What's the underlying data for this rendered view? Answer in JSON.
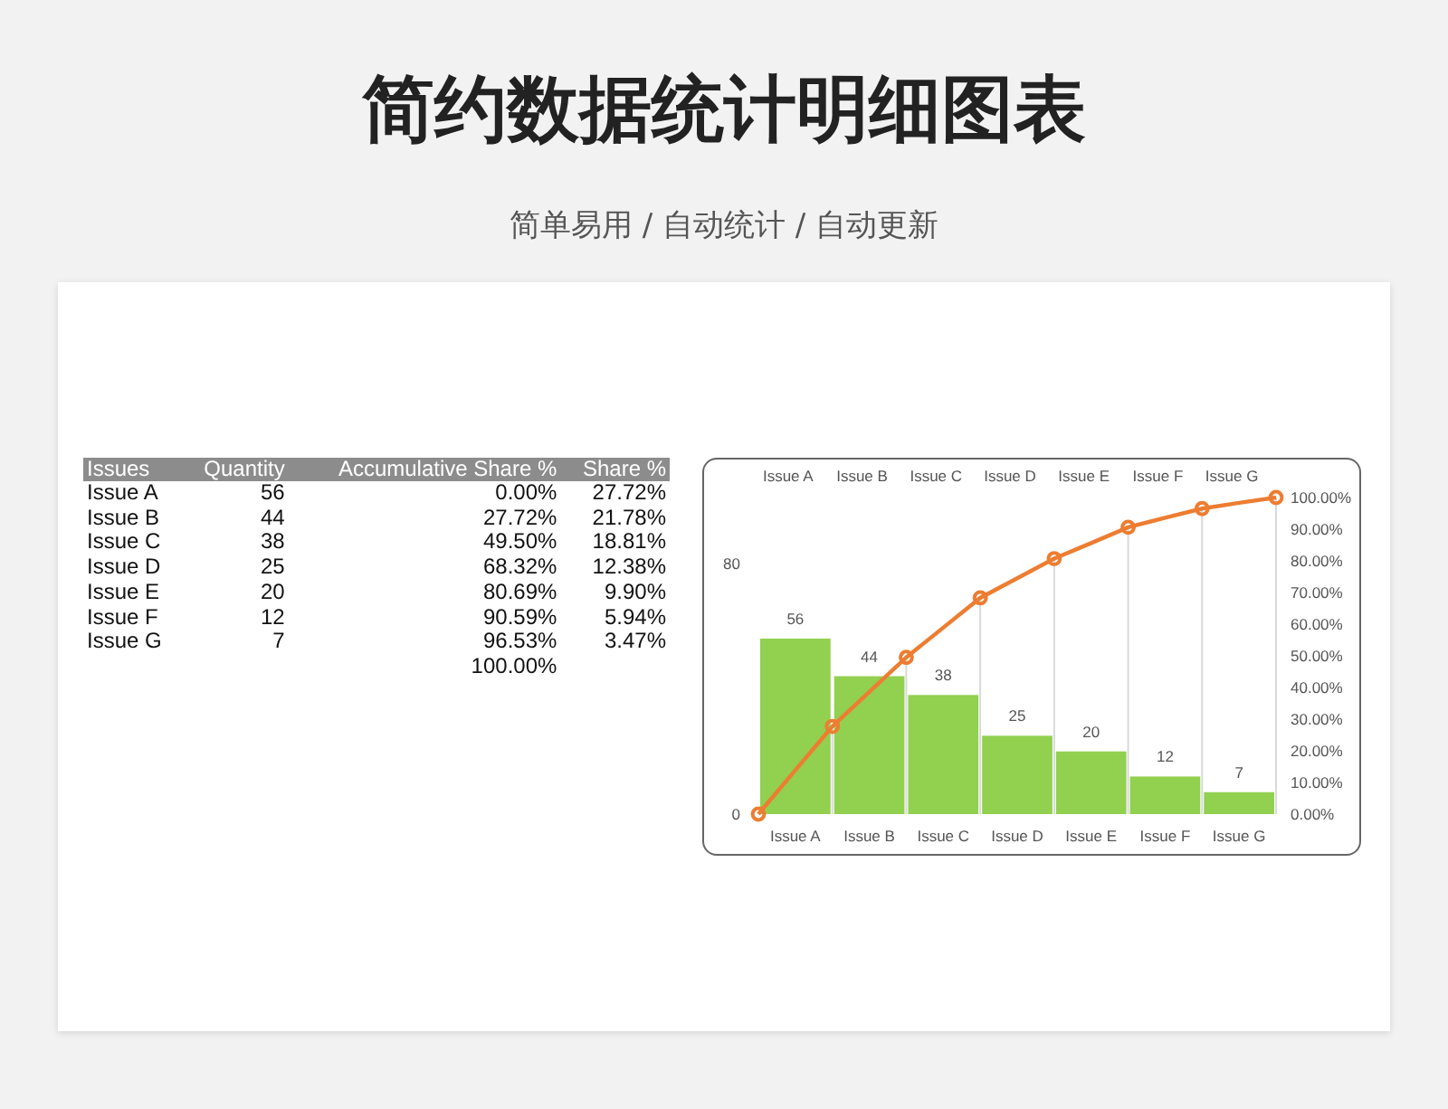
{
  "title": "简约数据统计明细图表",
  "subtitle": "简单易用 / 自动统计 / 自动更新",
  "table": {
    "columns": [
      "Issues",
      "Quantity",
      "Accumulative Share %",
      "Share %"
    ],
    "rows": [
      [
        "Issue A",
        "56",
        "0.00%",
        "27.72%"
      ],
      [
        "Issue B",
        "44",
        "27.72%",
        "21.78%"
      ],
      [
        "Issue C",
        "38",
        "49.50%",
        "18.81%"
      ],
      [
        "Issue D",
        "25",
        "68.32%",
        "12.38%"
      ],
      [
        "Issue E",
        "20",
        "80.69%",
        "9.90%"
      ],
      [
        "Issue F",
        "12",
        "90.59%",
        "5.94%"
      ],
      [
        "Issue G",
        "7",
        "96.53%",
        "3.47%"
      ],
      [
        "",
        "",
        "100.00%",
        ""
      ]
    ]
  },
  "chart": {
    "top_labels": [
      "Issue A",
      "Issue B",
      "Issue C",
      "Issue D",
      "Issue E",
      "Issue F",
      "Issue G"
    ],
    "chart_data": {
      "type": "bar",
      "categories": [
        null,
        "Issue A",
        null,
        "Issue B",
        null,
        "Issue C",
        null,
        "Issue D",
        null,
        "Issue E",
        null,
        "Issue F",
        null,
        "Issue G",
        null
      ],
      "ylim": [
        0,
        101
      ],
      "yticks": [
        0,
        80
      ],
      "series": [
        {
          "type": "bar",
          "color": "#92d050",
          "values": [
            null,
            56,
            null,
            44,
            null,
            38,
            null,
            25,
            null,
            20,
            null,
            12,
            null,
            7,
            null
          ],
          "value_labels": [
            null,
            "56",
            null,
            "44",
            null,
            "38",
            null,
            "25",
            null,
            "20",
            null,
            "12",
            null,
            "7",
            null
          ]
        },
        {
          "type": "line",
          "axis": "y2",
          "color": "#ed7d31",
          "values": [
            0,
            13.9,
            27.7,
            38.6,
            49.5,
            58.9,
            68.3,
            74.5,
            80.7,
            85.6,
            90.6,
            93.6,
            96.5,
            98.3,
            100
          ]
        }
      ],
      "y2lim": [
        0,
        100
      ],
      "y2ticks": [
        {
          "value": 0,
          "label": "0.00%"
        },
        {
          "value": 10,
          "label": "10.00%"
        },
        {
          "value": 20,
          "label": "20.00%"
        },
        {
          "value": 30,
          "label": "30.00%"
        },
        {
          "value": 40,
          "label": "40.00%"
        },
        {
          "value": 50,
          "label": "50.00%"
        },
        {
          "value": 60,
          "label": "60.00%"
        },
        {
          "value": 70,
          "label": "70.00%"
        },
        {
          "value": 80,
          "label": "80.00%"
        },
        {
          "value": 90,
          "label": "90.00%"
        },
        {
          "value": 100,
          "label": "100.00%"
        }
      ]
    }
  }
}
